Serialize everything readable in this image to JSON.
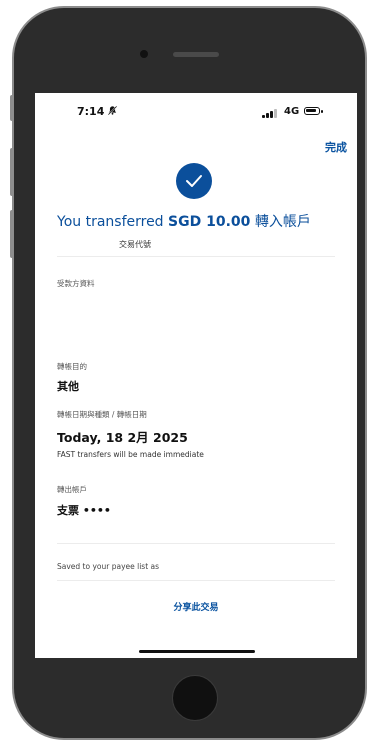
{
  "status_bar": {
    "time": "7:14",
    "network": "4G",
    "bell_icon": "bell-muted-icon"
  },
  "header": {
    "done_label": "完成"
  },
  "headline": {
    "prefix": "You transferred ",
    "amount": "SGD 10.00",
    "suffix": " 轉入帳戶"
  },
  "reference": {
    "label": "交易代號"
  },
  "payee_section": {
    "label": "受款方資料"
  },
  "purpose": {
    "label": "轉帳目的",
    "value": "其他"
  },
  "transfer_date": {
    "label": "轉帳日期與種類 / 轉帳日期",
    "value": "Today, 18 2月 2025",
    "note": "FAST transfers will be made immediate"
  },
  "from_account": {
    "label": "轉出帳戶",
    "value": "支票 ••••"
  },
  "saved": {
    "label": "Saved to your payee list as"
  },
  "actions": {
    "share_label": "分享此交易"
  },
  "colors": {
    "accent": "#0b4f9b",
    "link": "#0a53a0"
  }
}
